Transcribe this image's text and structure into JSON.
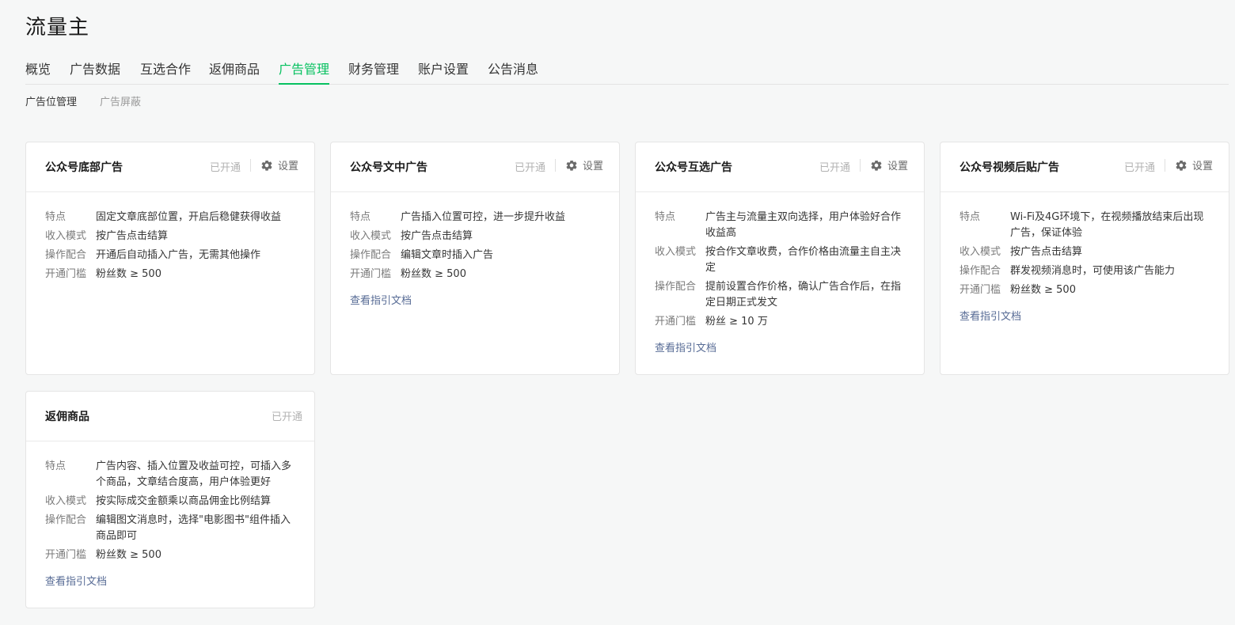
{
  "page": {
    "title": "流量主"
  },
  "main_tabs": [
    {
      "label": "概览"
    },
    {
      "label": "广告数据"
    },
    {
      "label": "互选合作"
    },
    {
      "label": "返佣商品"
    },
    {
      "label": "广告管理"
    },
    {
      "label": "财务管理"
    },
    {
      "label": "账户设置"
    },
    {
      "label": "公告消息"
    }
  ],
  "active_main_tab": "广告管理",
  "sub_tabs": [
    {
      "label": "广告位管理"
    },
    {
      "label": "广告屏蔽"
    }
  ],
  "active_sub_tab": "广告位管理",
  "labels": {
    "feature": "特点",
    "income": "收入模式",
    "operation": "操作配合",
    "threshold": "开通门槛"
  },
  "settings_label": "设置",
  "doc_link_label": "查看指引文档",
  "cards": [
    {
      "title": "公众号底部广告",
      "status": "已开通",
      "feature": "固定文章底部位置，开启后稳健获得收益",
      "income": "按广告点击结算",
      "operation": "开通后自动插入广告，无需其他操作",
      "threshold": "粉丝数 ≥ 500"
    },
    {
      "title": "公众号文中广告",
      "status": "已开通",
      "feature": "广告插入位置可控，进一步提升收益",
      "income": "按广告点击结算",
      "operation": "编辑文章时插入广告",
      "threshold": "粉丝数 ≥ 500"
    },
    {
      "title": "公众号互选广告",
      "status": "已开通",
      "feature": "广告主与流量主双向选择，用户体验好合作收益高",
      "income": "按合作文章收费，合作价格由流量主自主决定",
      "operation": "提前设置合作价格，确认广告合作后，在指定日期正式发文",
      "threshold": "粉丝 ≥ 10 万"
    },
    {
      "title": "公众号视频后贴广告",
      "status": "已开通",
      "feature": "Wi-Fi及4G环境下，在视频播放结束后出现广告，保证体验",
      "income": "按广告点击结算",
      "operation": "群发视频消息时，可使用该广告能力",
      "threshold": "粉丝数 ≥ 500"
    },
    {
      "title": "返佣商品",
      "status": "已开通",
      "feature": "广告内容、插入位置及收益可控，可插入多个商品，文章结合度高，用户体验更好",
      "income": "按实际成交金额乘以商品佣金比例结算",
      "operation": "编辑图文消息时，选择\"电影图书\"组件插入商品即可",
      "threshold": "粉丝数 ≥ 500"
    }
  ],
  "colors": {
    "accent": "#07c160",
    "link": "#576b95",
    "status": "#b2b2b2"
  }
}
